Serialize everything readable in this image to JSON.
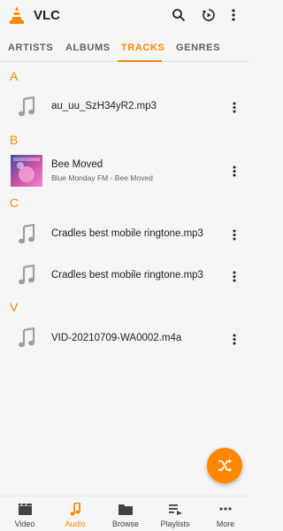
{
  "app": {
    "title": "VLC"
  },
  "colors": {
    "accent": "#ff8800",
    "text": "#212121",
    "secondary": "#616161",
    "background": "#f5f5f5"
  },
  "actions": {
    "icons": [
      "search-icon",
      "history-icon",
      "overflow-menu-icon"
    ]
  },
  "tabs": [
    {
      "label": "ARTISTS",
      "active": false
    },
    {
      "label": "ALBUMS",
      "active": false
    },
    {
      "label": "TRACKS",
      "active": true
    },
    {
      "label": "GENRES",
      "active": false
    }
  ],
  "sections": [
    {
      "letter": "A",
      "tracks": [
        {
          "title": "au_uu_SzH34yR2.mp3",
          "subtitle": "",
          "thumb": "music-note-icon"
        }
      ]
    },
    {
      "letter": "B",
      "tracks": [
        {
          "title": "Bee Moved",
          "subtitle": "Blue Monday FM - Bee Moved",
          "thumb": "album-art"
        }
      ]
    },
    {
      "letter": "C",
      "tracks": [
        {
          "title": "Cradles best mobile ringtone.mp3",
          "subtitle": "",
          "thumb": "music-note-icon"
        },
        {
          "title": "Cradles best mobile ringtone.mp3",
          "subtitle": "",
          "thumb": "music-note-icon"
        }
      ]
    },
    {
      "letter": "V",
      "tracks": [
        {
          "title": "VID-20210709-WA0002.m4a",
          "subtitle": "",
          "thumb": "music-note-icon"
        }
      ]
    }
  ],
  "fab": {
    "icon": "shuffle-icon"
  },
  "bottom_nav": [
    {
      "label": "Video",
      "icon": "video-icon",
      "active": false
    },
    {
      "label": "Audio",
      "icon": "music-note-icon",
      "active": true
    },
    {
      "label": "Browse",
      "icon": "folder-icon",
      "active": false
    },
    {
      "label": "Playlists",
      "icon": "playlist-icon",
      "active": false
    },
    {
      "label": "More",
      "icon": "more-horiz-icon",
      "active": false
    }
  ]
}
